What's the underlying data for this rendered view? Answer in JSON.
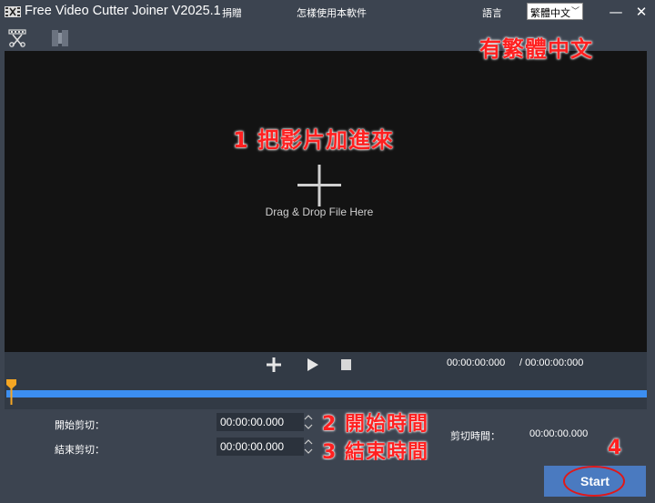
{
  "window": {
    "title": "Free Video Cutter Joiner V2025.1",
    "donate_label": "捐贈",
    "howto_label": "怎樣使用本軟件",
    "language_label": "語言",
    "language_value": "繁體中文",
    "minimize_icon": "minimize-icon",
    "close_icon": "close-icon"
  },
  "toolbar": {
    "cut_icon": "scissors-film-icon",
    "join_icon": "film-join-icon"
  },
  "preview": {
    "drop_text": "Drag & Drop File Here",
    "add_icon": "plus-icon"
  },
  "annotations": {
    "corner": "有繁體中文",
    "step1": "1  把影片加進來",
    "step2": "2  開始時間",
    "step3": "3  結束時間",
    "step4": "4"
  },
  "controls": {
    "current_time": "00:00:00:000",
    "total_time": "/ 00:00:00:000",
    "add_icon": "plus-icon",
    "play_icon": "play-icon",
    "stop_icon": "stop-icon"
  },
  "cut": {
    "start_label": "開始剪切：",
    "start_value": "00:00:00.000",
    "end_label": "結束剪切：",
    "end_value": "00:00:00.000",
    "duration_label": "剪切時間：",
    "duration_value": "00:00:00.000"
  },
  "actions": {
    "start_label": "Start"
  },
  "colors": {
    "background": "#3c4450",
    "preview": "#131313",
    "timeline": "#3c8ef0",
    "marker": "#f5a623",
    "start_button": "#4a7ac0",
    "annotation": "#ff2020"
  }
}
